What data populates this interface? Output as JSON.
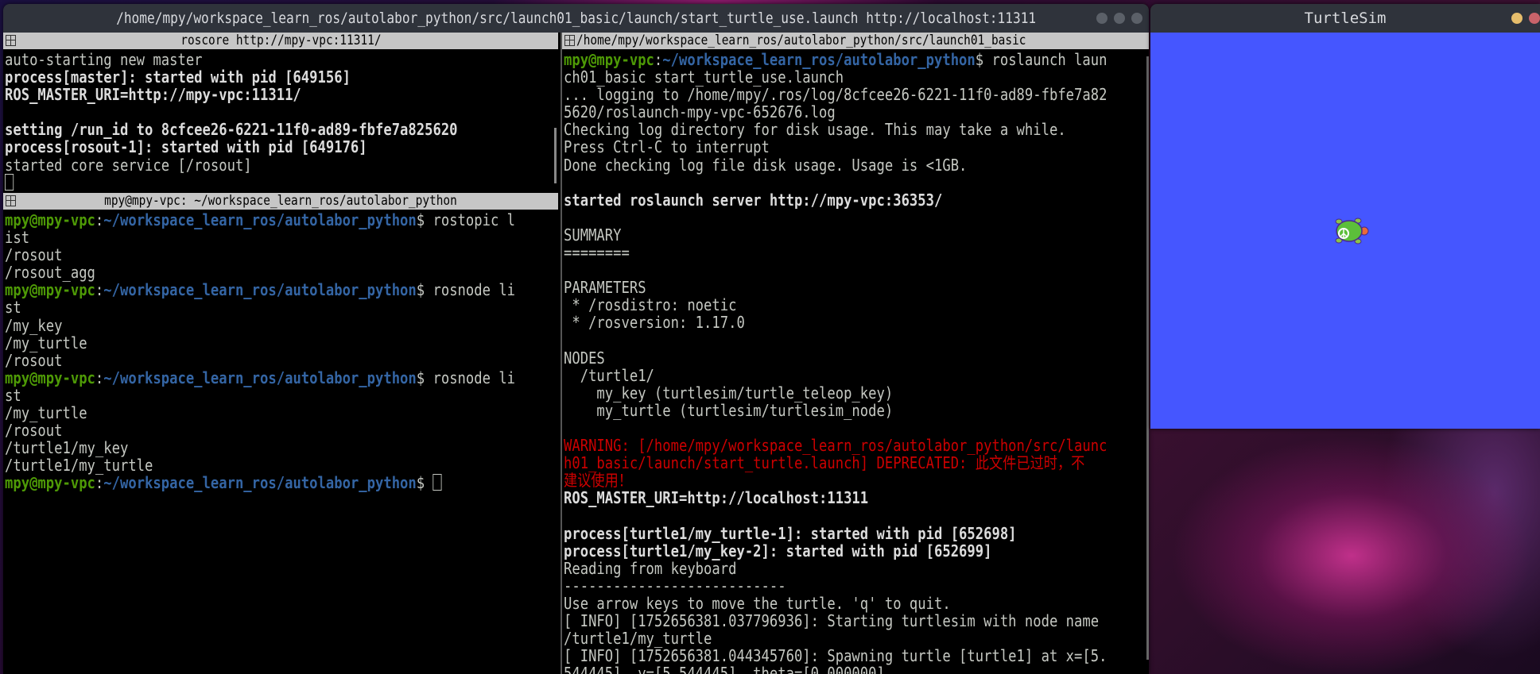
{
  "terminal": {
    "title": "/home/mpy/workspace_learn_ros/autolabor_python/src/launch01_basic/launch/start_turtle_use.launch http://localhost:11311",
    "panes": [
      {
        "header": "roscore http://mpy-vpc:11311/",
        "lines": [
          [
            {
              "t": "auto-starting new master",
              "c": ""
            }
          ],
          [
            {
              "t": "process[master]: started with pid [649156]",
              "c": "b"
            }
          ],
          [
            {
              "t": "ROS_MASTER_URI=http://mpy-vpc:11311/",
              "c": "b"
            }
          ],
          [
            {
              "t": "",
              "c": ""
            }
          ],
          [
            {
              "t": "setting /run_id to 8cfcee26-6221-11f0-ad89-fbfe7a825620",
              "c": "b"
            }
          ],
          [
            {
              "t": "process[rosout-1]: started with pid [649176]",
              "c": "b"
            }
          ],
          [
            {
              "t": "started core service [/rosout]",
              "c": ""
            }
          ],
          [
            {
              "t": "",
              "c": "cursor"
            }
          ]
        ]
      },
      {
        "header": "mpy@mpy-vpc: ~/workspace_learn_ros/autolabor_python",
        "lines": [
          [
            {
              "t": "mpy@mpy-vpc",
              "c": "g"
            },
            {
              "t": ":",
              "c": ""
            },
            {
              "t": "~/workspace_learn_ros/autolabor_python",
              "c": "u"
            },
            {
              "t": "$ rostopic l",
              "c": ""
            }
          ],
          [
            {
              "t": "ist",
              "c": ""
            }
          ],
          [
            {
              "t": "/rosout",
              "c": ""
            }
          ],
          [
            {
              "t": "/rosout_agg",
              "c": ""
            }
          ],
          [
            {
              "t": "mpy@mpy-vpc",
              "c": "g"
            },
            {
              "t": ":",
              "c": ""
            },
            {
              "t": "~/workspace_learn_ros/autolabor_python",
              "c": "u"
            },
            {
              "t": "$ rosnode li",
              "c": ""
            }
          ],
          [
            {
              "t": "st",
              "c": ""
            }
          ],
          [
            {
              "t": "/my_key",
              "c": ""
            }
          ],
          [
            {
              "t": "/my_turtle",
              "c": ""
            }
          ],
          [
            {
              "t": "/rosout",
              "c": ""
            }
          ],
          [
            {
              "t": "mpy@mpy-vpc",
              "c": "g"
            },
            {
              "t": ":",
              "c": ""
            },
            {
              "t": "~/workspace_learn_ros/autolabor_python",
              "c": "u"
            },
            {
              "t": "$ rosnode li",
              "c": ""
            }
          ],
          [
            {
              "t": "st",
              "c": ""
            }
          ],
          [
            {
              "t": "/my_turtle",
              "c": ""
            }
          ],
          [
            {
              "t": "/rosout",
              "c": ""
            }
          ],
          [
            {
              "t": "/turtle1/my_key",
              "c": ""
            }
          ],
          [
            {
              "t": "/turtle1/my_turtle",
              "c": ""
            }
          ],
          [
            {
              "t": "mpy@mpy-vpc",
              "c": "g"
            },
            {
              "t": ":",
              "c": ""
            },
            {
              "t": "~/workspace_learn_ros/autolabor_python",
              "c": "u"
            },
            {
              "t": "$ ",
              "c": ""
            },
            {
              "t": "",
              "c": "cursor"
            }
          ]
        ]
      },
      {
        "header": "/home/mpy/workspace_learn_ros/autolabor_python/src/launch01_basic",
        "lines": [
          [
            {
              "t": "mpy@mpy-vpc",
              "c": "g"
            },
            {
              "t": ":",
              "c": ""
            },
            {
              "t": "~/workspace_learn_ros/autolabor_python",
              "c": "u"
            },
            {
              "t": "$ roslaunch laun",
              "c": ""
            }
          ],
          [
            {
              "t": "ch01_basic start_turtle_use.launch",
              "c": ""
            }
          ],
          [
            {
              "t": "... logging to /home/mpy/.ros/log/8cfcee26-6221-11f0-ad89-fbfe7a82",
              "c": ""
            }
          ],
          [
            {
              "t": "5620/roslaunch-mpy-vpc-652676.log",
              "c": ""
            }
          ],
          [
            {
              "t": "Checking log directory for disk usage. This may take a while.",
              "c": ""
            }
          ],
          [
            {
              "t": "Press Ctrl-C to interrupt",
              "c": ""
            }
          ],
          [
            {
              "t": "Done checking log file disk usage. Usage is <1GB.",
              "c": ""
            }
          ],
          [
            {
              "t": "",
              "c": ""
            }
          ],
          [
            {
              "t": "started roslaunch server http://mpy-vpc:36353/",
              "c": "b"
            }
          ],
          [
            {
              "t": "",
              "c": ""
            }
          ],
          [
            {
              "t": "SUMMARY",
              "c": ""
            }
          ],
          [
            {
              "t": "========",
              "c": ""
            }
          ],
          [
            {
              "t": "",
              "c": ""
            }
          ],
          [
            {
              "t": "PARAMETERS",
              "c": ""
            }
          ],
          [
            {
              "t": " * /rosdistro: noetic",
              "c": ""
            }
          ],
          [
            {
              "t": " * /rosversion: 1.17.0",
              "c": ""
            }
          ],
          [
            {
              "t": "",
              "c": ""
            }
          ],
          [
            {
              "t": "NODES",
              "c": ""
            }
          ],
          [
            {
              "t": "  /turtle1/",
              "c": ""
            }
          ],
          [
            {
              "t": "    my_key (turtlesim/turtle_teleop_key)",
              "c": ""
            }
          ],
          [
            {
              "t": "    my_turtle (turtlesim/turtlesim_node)",
              "c": ""
            }
          ],
          [
            {
              "t": "",
              "c": ""
            }
          ],
          [
            {
              "t": "WARNING: [/home/mpy/workspace_learn_ros/autolabor_python/src/launc",
              "c": "r"
            }
          ],
          [
            {
              "t": "h01_basic/launch/start_turtle.launch] DEPRECATED: 此文件已过时，不",
              "c": "r"
            }
          ],
          [
            {
              "t": "建议使用！",
              "c": "r"
            }
          ],
          [
            {
              "t": "ROS_MASTER_URI=http://localhost:11311",
              "c": "b"
            }
          ],
          [
            {
              "t": "",
              "c": ""
            }
          ],
          [
            {
              "t": "process[turtle1/my_turtle-1]: started with pid [652698]",
              "c": "b"
            }
          ],
          [
            {
              "t": "process[turtle1/my_key-2]: started with pid [652699]",
              "c": "b"
            }
          ],
          [
            {
              "t": "Reading from keyboard",
              "c": ""
            }
          ],
          [
            {
              "t": "---------------------------",
              "c": ""
            }
          ],
          [
            {
              "t": "Use arrow keys to move the turtle. 'q' to quit.",
              "c": ""
            }
          ],
          [
            {
              "t": "[ INFO] [1752656381.037796936]: Starting turtlesim with node name",
              "c": ""
            }
          ],
          [
            {
              "t": "/turtle1/my_turtle",
              "c": ""
            }
          ],
          [
            {
              "t": "[ INFO] [1752656381.044345760]: Spawning turtle [turtle1] at x=[5.",
              "c": ""
            }
          ],
          [
            {
              "t": "544445], y=[5.544445], theta=[0.000000]",
              "c": ""
            }
          ]
        ]
      }
    ]
  },
  "turtlesim": {
    "title": "TurtleSim",
    "background_color": "#4556ff"
  }
}
